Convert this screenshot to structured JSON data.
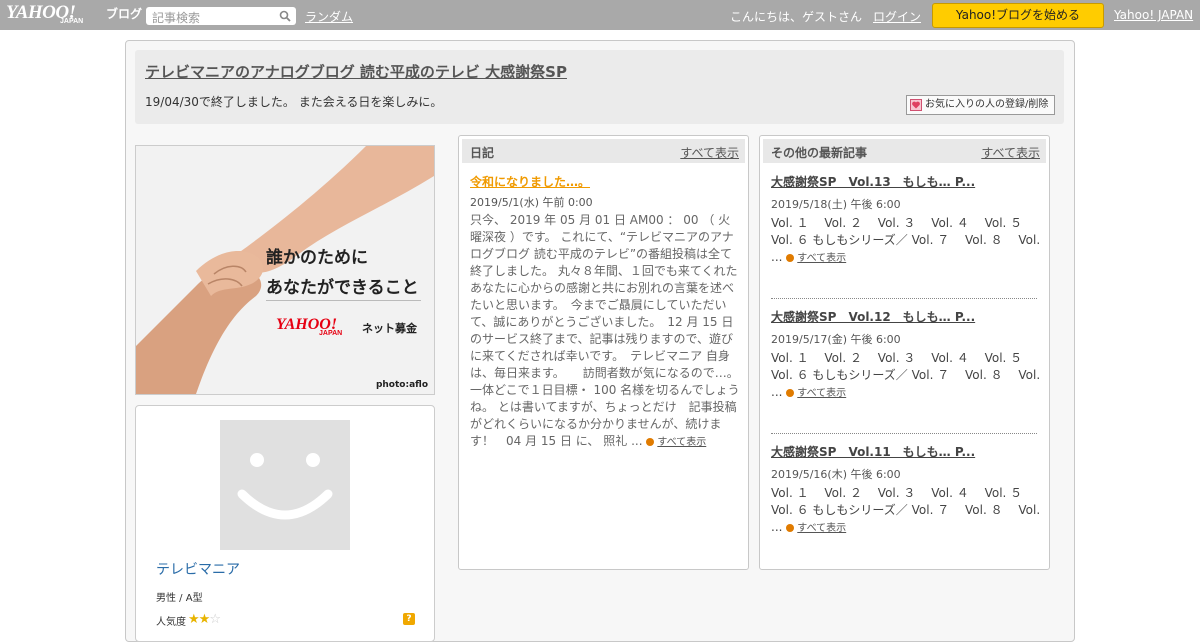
{
  "topbar": {
    "logo_text": "YAHOO!",
    "logo_sub": "JAPAN",
    "logo_blog": "ブログ",
    "search_placeholder": "記事検索",
    "random_label": "ランダム",
    "greeting": "こんにちは、ゲストさん",
    "login_label": "ログイン",
    "start_button": "Yahoo!ブログを始める",
    "yahoo_japan_link": "Yahoo! JAPAN"
  },
  "header": {
    "title": "テレビマニアのアナログブログ 読む平成のテレビ 大感謝祭SP",
    "description": "19/04/30で終了しました。 また会える日を楽しみに。",
    "favorite_button": "お気に入りの人の登録/削除"
  },
  "banner": {
    "line1": "誰かのために",
    "line2": "あなたができること",
    "logo": "YAHOO!",
    "logo_sub": "JAPAN",
    "service": "ネット募金",
    "credit": "photo:aflo"
  },
  "profile": {
    "name": "テレビマニア",
    "meta": "男性 / A型",
    "popularity_label": "人気度",
    "popularity_stars": 2,
    "popularity_max": 3,
    "help_icon": "?"
  },
  "diary": {
    "heading": "日記",
    "view_all": "すべて表示",
    "post": {
      "title": "令和になりました…。",
      "date": "2019/5/1(水) 午前 0:00",
      "body": "只今、 2019 年 05 月 01 日 AM00 ： 00 （ 火曜深夜 ）です。 これにて、“テレビマニアのアナログブログ 読む平成のテレビ”の番組投稿は全て終了しました。 丸々８年間、１回でも来てくれたあなたに心からの感謝と共にお別れの言葉を述べたいと思います。　今までご贔屓にしていただいて、誠にありがとうございました。　12 月 15 日のサービス終了まで、記事は残りますので、遊びに来てくだされば幸いです。　テレビマニア 自身は、毎日来ます。　　訪問者数が気になるので…。　一体どこで１日目標・ 100 名様を切るんでしょうね。 とは書いてますが、ちょっとだけ　記事投稿がどれくらいになるか分かりませんが、続けます！　04 月 15 日 に、 照礼 ...",
      "more": "すべて表示"
    }
  },
  "others": {
    "heading": "その他の最新記事",
    "view_all": "すべて表示",
    "articles": [
      {
        "title": "大感謝祭SP　Vol.13　もしも… P...",
        "date": "2019/5/18(土) 午後 6:00",
        "body": "Vol. １　 Vol. ２　 Vol. ３　 Vol. ４　 Vol. ５　Vol. ６ もしもシリーズ／ Vol. ７　 Vol. ８　 Vol. ...",
        "more": "すべて表示"
      },
      {
        "title": "大感謝祭SP　Vol.12　もしも… P...",
        "date": "2019/5/17(金) 午後 6:00",
        "body": "Vol. １　 Vol. ２　 Vol. ３　 Vol. ４　 Vol. ５　Vol. ６ もしもシリーズ／ Vol. ７　 Vol. ８　 Vol. ...",
        "more": "すべて表示"
      },
      {
        "title": "大感謝祭SP　Vol.11　もしも… P...",
        "date": "2019/5/16(木) 午後 6:00",
        "body": "Vol. １　 Vol. ２　 Vol. ３　 Vol. ４　 Vol. ５　Vol. ６ もしもシリーズ／ Vol. ７　 Vol. ８　 Vol. ...",
        "more": "すべて表示"
      }
    ]
  }
}
